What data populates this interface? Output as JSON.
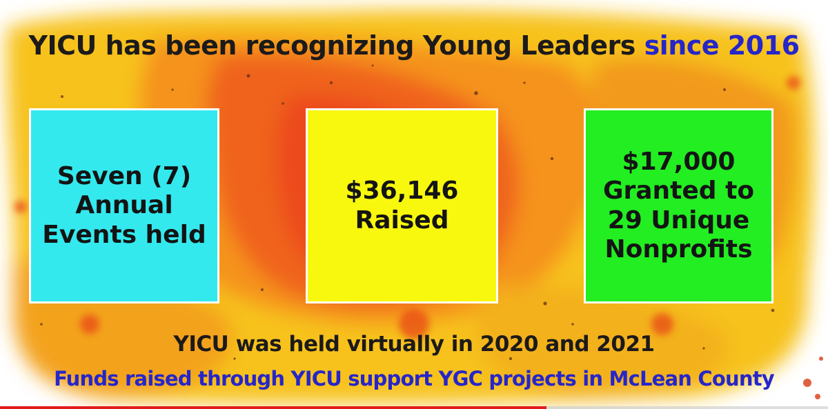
{
  "title": {
    "main": "YICU has been recognizing Young Leaders ",
    "accent": "since 2016"
  },
  "cards": [
    {
      "lines": [
        "Seven (7)",
        "Annual",
        "Events held"
      ],
      "color": "#33e9ee"
    },
    {
      "lines": [
        "$36,146",
        "Raised"
      ],
      "color": "#f8f80e"
    },
    {
      "lines": [
        "$17,000",
        "Granted to",
        "29 Unique",
        "Nonprofits"
      ],
      "color": "#22ee22"
    }
  ],
  "notes": {
    "virtual": "YICU was held virtually in 2020 and 2021",
    "funds": "Funds raised through YICU support YGC projects in McLean County"
  },
  "colors": {
    "text_dark": "#1c1a1a",
    "text_accent": "#2626c9",
    "paint_orange": "#f26a1b",
    "paint_yellow": "#f7c21c",
    "progress": "#e21b1b"
  },
  "video_progress": 0.66
}
